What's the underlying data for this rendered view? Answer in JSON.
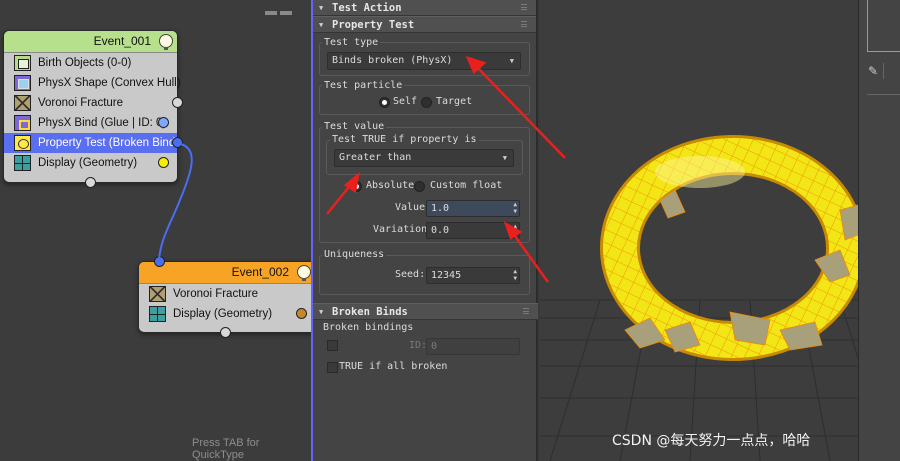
{
  "particle_view": {
    "quicktype_hint": "Press TAB for QuickType",
    "event1": {
      "title": "Event_001",
      "operators": [
        {
          "label": "Birth Objects (0-0)",
          "icon": "birth-objects-icon"
        },
        {
          "label": "PhysX Shape (Convex Hull)",
          "icon": "physx-shape-icon"
        },
        {
          "label": "Voronoi Fracture",
          "icon": "voronoi-fracture-icon"
        },
        {
          "label": "PhysX Bind (Glue | ID: 0)",
          "icon": "physx-bind-icon"
        },
        {
          "label": "Property Test (Broken Bind...",
          "icon": "property-test-icon",
          "selected": true
        },
        {
          "label": "Display (Geometry)",
          "icon": "display-icon"
        }
      ],
      "header_color": "#b7e08c"
    },
    "event2": {
      "title": "Event_002",
      "operators": [
        {
          "label": "Voronoi Fracture",
          "icon": "voronoi-fracture-icon"
        },
        {
          "label": "Display (Geometry)",
          "icon": "display-icon"
        }
      ],
      "header_color": "#f7a326"
    },
    "wire_color": "#4a6ef0"
  },
  "panel": {
    "rollout_test_action": "Test Action",
    "rollout_property_test": "Property Test",
    "test_type": {
      "label": "Test type",
      "value": "Binds broken (PhysX)"
    },
    "test_particle": {
      "label": "Test particle",
      "self": "Self",
      "target": "Target",
      "selected": "Self"
    },
    "test_value": {
      "label": "Test value",
      "condition_label": "Test TRUE if property is",
      "condition_value": "Greater than",
      "absolute": "Absolute",
      "custom_float": "Custom float",
      "selected": "Absolute",
      "value_label": "Value:",
      "value": "1.0",
      "variation_label": "Variation:",
      "variation": "0.0"
    },
    "uniqueness": {
      "label": "Uniqueness",
      "seed_label": "Seed:",
      "seed": "12345"
    },
    "rollout_broken_binds": "Broken Binds",
    "broken_bindings": {
      "label": "Broken bindings",
      "id_label": "ID:",
      "id_value": "0",
      "true_if_all": "TRUE if all broken"
    }
  },
  "viewport": {
    "torus_color": "#f2e616",
    "wire_color": "#f08a00"
  },
  "sidebar": {
    "pin_icon": "pin-icon"
  },
  "annotation_arrow_color": "#e8201e",
  "watermark": "CSDN @每天努力一点点，哈哈"
}
